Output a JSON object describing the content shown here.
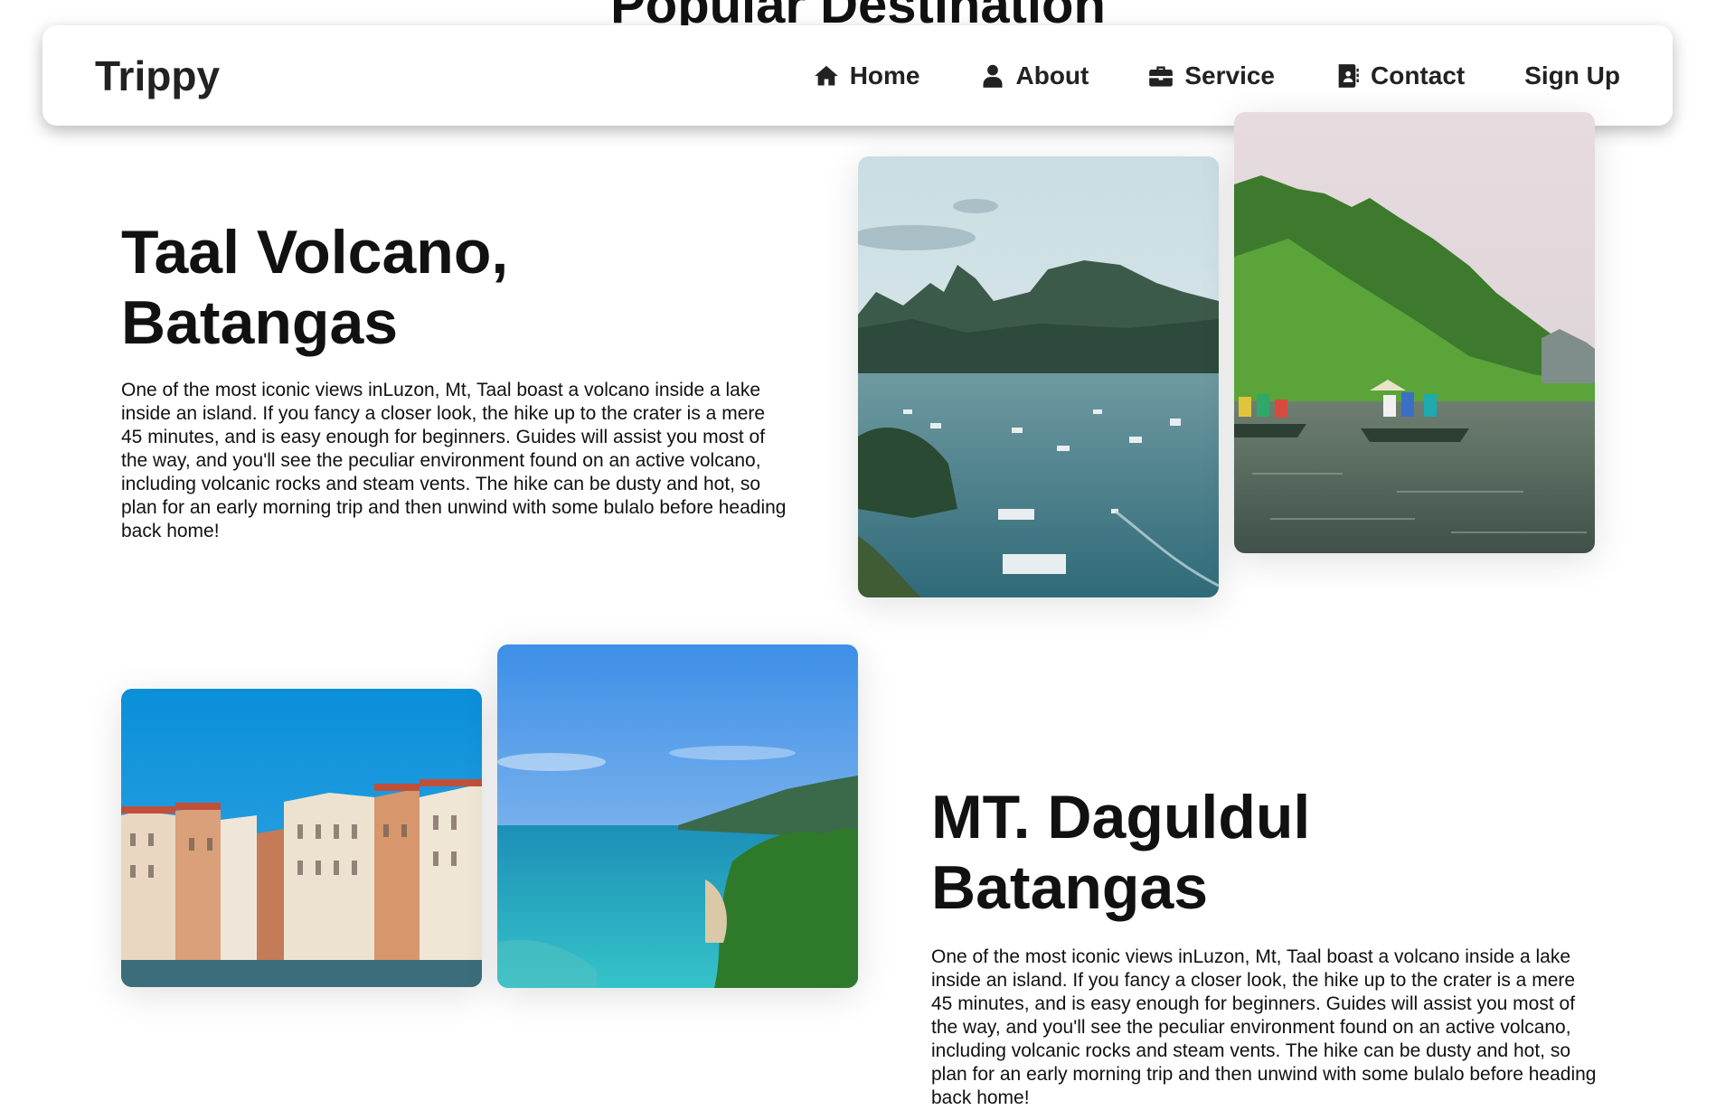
{
  "page": {
    "heading": "Popular Destination"
  },
  "nav": {
    "brand": "Trippy",
    "links": [
      {
        "label": "Home",
        "icon": "home-icon"
      },
      {
        "label": "About",
        "icon": "user-icon"
      },
      {
        "label": "Service",
        "icon": "briefcase-icon"
      },
      {
        "label": "Contact",
        "icon": "contact-book-icon"
      },
      {
        "label": "Sign Up",
        "icon": ""
      }
    ]
  },
  "destinations": [
    {
      "title_line1": "Taal Volcano,",
      "title_line2": "Batangas",
      "description": "One of the most iconic views inLuzon, Mt, Taal boast a volcano inside a lake inside an island. If you fancy a closer look, the hike up to the crater is a mere 45 minutes, and is easy enough for beginners. Guides will assist you most of the way, and you'll see the peculiar environment found on an active volcano, including volcanic rocks and steam vents. The hike can be dusty and hot, so plan for an early morning trip and then unwind with some bulalo before heading back home!",
      "images": [
        "bay-karst-islands-photo",
        "river-boats-photo"
      ]
    },
    {
      "title": "MT. Daguldul Batangas",
      "description": "One of the most iconic views inLuzon, Mt, Taal boast a volcano inside a lake inside an island. If you fancy a closer look, the hike up to the crater is a mere 45 minutes, and is easy enough for beginners. Guides will assist you most of the way, and you'll see the peculiar environment found on an active volcano, including volcanic rocks and steam vents. The hike can be dusty and hot, so plan for an early morning trip and then unwind with some bulalo before heading back home!",
      "images": [
        "venice-canal-photo",
        "tropical-coast-photo"
      ]
    }
  ]
}
